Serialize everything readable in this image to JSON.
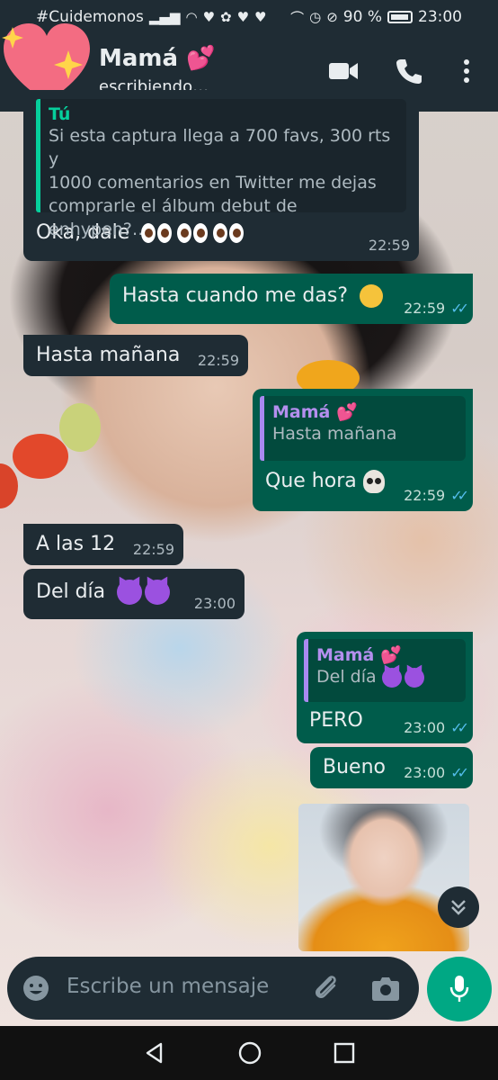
{
  "status_bar": {
    "carrier": "#Cuidemonos",
    "battery": "90 %",
    "time": "23:00"
  },
  "header": {
    "contact_name": "Mamá 💕",
    "contact_status": "escribiendo…"
  },
  "messages": [
    {
      "direction": "in",
      "quote_author": "Tú",
      "quote_lines": [
        "Si esta captura llega a 700 favs, 300 rts y",
        "1000 comentarios en Twitter me dejas",
        "comprarle el álbum debut de enhypen?…"
      ],
      "text": "Oka, dale",
      "time": "22:59"
    },
    {
      "direction": "out",
      "text": "Hasta cuando me das?",
      "time": "22:59"
    },
    {
      "direction": "in",
      "text": "Hasta mañana",
      "time": "22:59"
    },
    {
      "direction": "out",
      "quote_author": "Mamá 💕",
      "quote_text": "Hasta mañana",
      "text": "Que hora",
      "time": "22:59"
    },
    {
      "direction": "in",
      "text": "A las 12",
      "time": "22:59"
    },
    {
      "direction": "in",
      "text": "Del día",
      "time": "23:00"
    },
    {
      "direction": "out",
      "quote_author": "Mamá 💕",
      "quote_text": "Del día",
      "text": "PERO",
      "time": "23:00"
    },
    {
      "direction": "out",
      "text": "Bueno",
      "time": "23:00"
    }
  ],
  "composer": {
    "placeholder": "Escribe un mensaje"
  },
  "colors": {
    "incoming_bubble": "#1f2c34",
    "outgoing_bubble": "#005c4b",
    "accent": "#00a884",
    "read_ticks": "#53bdeb"
  }
}
